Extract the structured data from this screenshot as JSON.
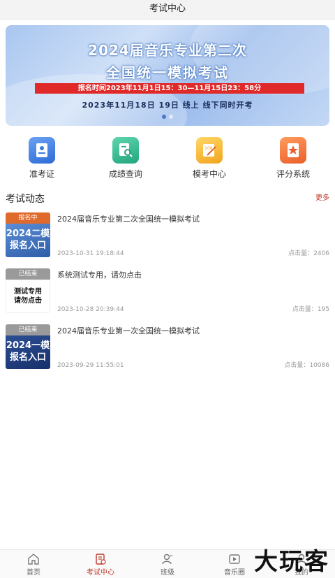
{
  "header": {
    "title": "考试中心"
  },
  "banner": {
    "line1": "2024届音乐专业第二次",
    "line2": "全国统一模拟考试",
    "signup": "报名时间2023年11月1日15：30—11月15日23：58分",
    "date": "2023年11月18日  19日  线上  线下同时开考"
  },
  "quick": [
    {
      "label": "准考证",
      "icon": "admission-ticket-icon",
      "color": "#3d7be0"
    },
    {
      "label": "成绩查询",
      "icon": "score-search-icon",
      "color": "#2db58c"
    },
    {
      "label": "模考中心",
      "icon": "mock-exam-icon",
      "color": "#f4b32c"
    },
    {
      "label": "评分系统",
      "icon": "grading-icon",
      "color": "#f07a3a"
    }
  ],
  "section": {
    "title": "考试动态",
    "more": "更多"
  },
  "news": [
    {
      "status": "报名中",
      "thumb_line1": "2024二模",
      "thumb_line2": "报名入口",
      "title": "2024届音乐专业第二次全国统一模拟考试",
      "time": "2023-10-31 19:18:44",
      "clicks": "点击量：2406"
    },
    {
      "status": "已结束",
      "thumb_line1": "测试专用",
      "thumb_line2": "请勿点击",
      "title": "系统测试专用，请勿点击",
      "time": "2023-10-28 20:39:44",
      "clicks": "点击量：195"
    },
    {
      "status": "已结束",
      "thumb_line1": "2024一模",
      "thumb_line2": "报名入口",
      "title": "2024届音乐专业第一次全国统一模拟考试",
      "time": "2023-09-29 11:55:01",
      "clicks": "点击量：10086"
    }
  ],
  "tabs": [
    {
      "label": "首页",
      "icon": "home-icon"
    },
    {
      "label": "考试中心",
      "icon": "exam-center-icon"
    },
    {
      "label": "班级",
      "icon": "class-icon"
    },
    {
      "label": "音乐圈",
      "icon": "music-circle-icon"
    },
    {
      "label": "我的",
      "icon": "profile-icon"
    }
  ],
  "watermark": "大玩客",
  "colors": {
    "accent": "#c0392b",
    "status_active": "#e0692c",
    "status_ended": "#9a9a9a"
  }
}
